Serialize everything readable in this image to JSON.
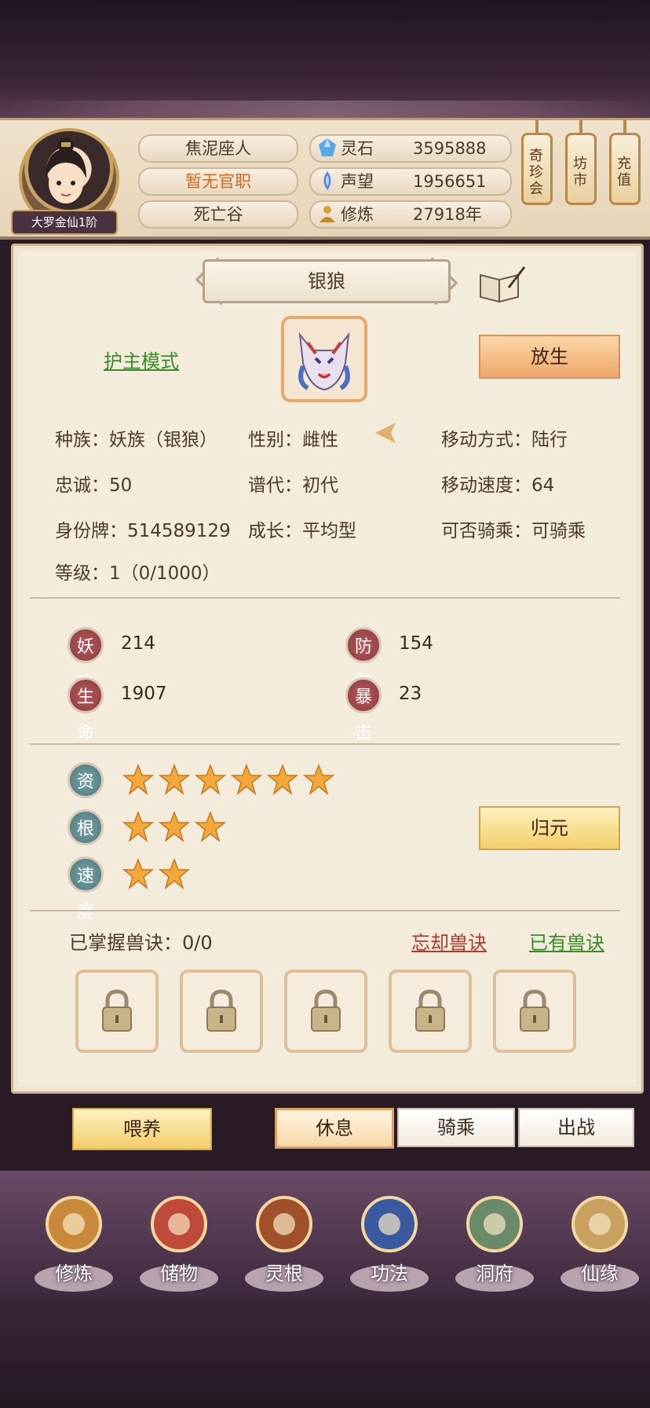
{
  "header": {
    "rank_badge": "大罗金仙1阶",
    "name": "焦泥座人",
    "position": "暂无官职",
    "location": "死亡谷",
    "resources": [
      {
        "icon": "spirit-stone-icon",
        "label": "灵石",
        "value": "3595888"
      },
      {
        "icon": "reputation-icon",
        "label": "声望",
        "value": "1956651"
      },
      {
        "icon": "cultivation-icon",
        "label": "修炼",
        "value": "27918年"
      }
    ],
    "side_buttons": [
      "奇珍会",
      "坊市",
      "充值"
    ]
  },
  "pet": {
    "name": "银狼",
    "guard_mode": "护主模式",
    "release_button": "放生",
    "info": [
      [
        "种族：妖族（银狼）",
        "性别：雌性",
        "移动方式：陆行"
      ],
      [
        "忠诚：50",
        "谱代：初代",
        "移动速度：64"
      ],
      [
        "身份牌：514589129",
        "成长：平均型",
        "可否骑乘：可骑乘"
      ],
      [
        "等级：1（0/1000）"
      ]
    ],
    "stats": [
      {
        "label": "妖攻",
        "value": "214"
      },
      {
        "label": "防御",
        "value": "154"
      },
      {
        "label": "生命",
        "value": "1907"
      },
      {
        "label": "暴击",
        "value": "23"
      }
    ],
    "talents": [
      {
        "label": "资质",
        "stars": 6
      },
      {
        "label": "根骨",
        "stars": 3
      },
      {
        "label": "速度",
        "stars": 2
      }
    ],
    "return_button": "归元",
    "skills_label": "已掌握兽诀：0/0",
    "forget_link": "忘却兽诀",
    "owned_link": "已有兽诀"
  },
  "actions": {
    "feed": "喂养",
    "rest": "休息",
    "ride": "骑乘",
    "battle": "出战"
  },
  "nav": [
    "修炼",
    "储物",
    "灵根",
    "功法",
    "洞府",
    "仙缘"
  ],
  "colors": {
    "guard_link": "#3a8a2a",
    "forget_link": "#b03a2a",
    "owned_link": "#3a8a2a",
    "position_text": "#d06a22",
    "star": "#f2a83a"
  }
}
